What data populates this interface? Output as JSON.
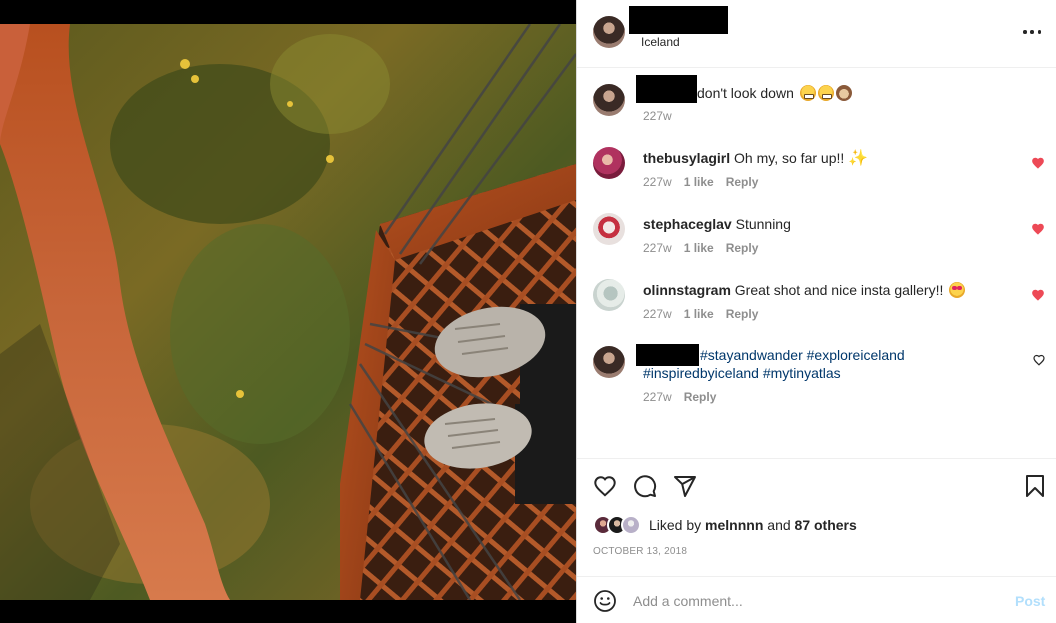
{
  "header": {
    "location": "Iceland"
  },
  "comments": [
    {
      "username": "",
      "text": "don't look down",
      "time": "227w",
      "likes": "",
      "reply": "",
      "liked": false,
      "emojis": [
        "grimace",
        "grimace",
        "see-no-evil-monkey"
      ]
    },
    {
      "username": "thebusylagirl",
      "text": "Oh my, so far up!!",
      "time": "227w",
      "likes": "1 like",
      "reply": "Reply",
      "liked": true,
      "emojis": [
        "star"
      ]
    },
    {
      "username": "stephaceglav",
      "text": "Stunning",
      "time": "227w",
      "likes": "1 like",
      "reply": "Reply",
      "liked": true
    },
    {
      "username": "olinnstagram",
      "text": "Great shot and nice insta gallery!!",
      "time": "227w",
      "likes": "1 like",
      "reply": "Reply",
      "liked": true,
      "emojis": [
        "heart-eyes"
      ]
    },
    {
      "username": "",
      "line1": "#stayandwander #exploreiceland",
      "line2": "#inspiredbyiceland #mytinyatlas",
      "time": "227w",
      "reply": "Reply",
      "liked": false
    }
  ],
  "likes": {
    "prefix": "Liked by",
    "user": "melnnnn",
    "joiner": "and",
    "others": "87 others"
  },
  "date": "OCTOBER 13, 2018",
  "add_comment": {
    "placeholder": "Add a comment...",
    "post_label": "Post"
  },
  "colors": {
    "like_red": "#ed4956",
    "hashtag_blue": "#00376b",
    "post_disabled": "#b2dffc",
    "meta_gray": "#8e8e8e"
  }
}
